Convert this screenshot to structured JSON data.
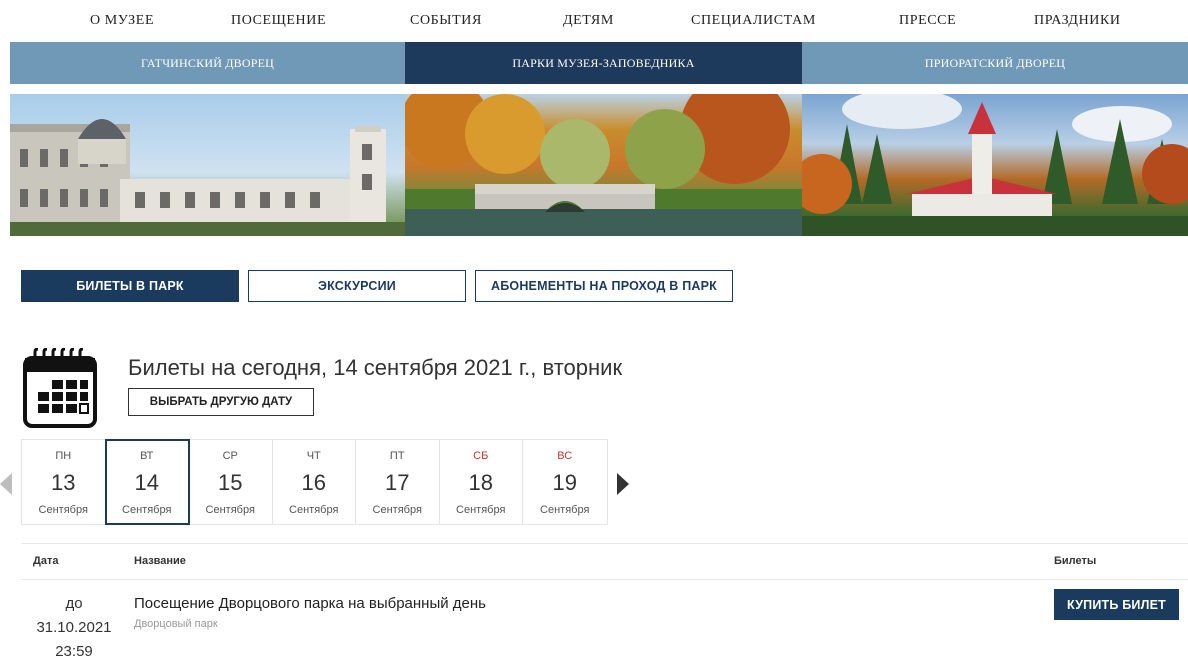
{
  "topnav": [
    "О МУЗЕЕ",
    "ПОСЕЩЕНИЕ",
    "СОБЫТИЯ",
    "ДЕТЯМ",
    "СПЕЦИАЛИСТАМ",
    "ПРЕССЕ",
    "ПРАЗДНИКИ"
  ],
  "subnav": [
    "ГАТЧИНСКИЙ ДВОРЕЦ",
    "ПАРКИ МУЗЕЯ-ЗАПОВЕДНИКА",
    "ПРИОРАТСКИЙ ДВОРЕЦ"
  ],
  "tabs": [
    "БИЛЕТЫ В ПАРК",
    "ЭКСКУРСИИ",
    "АБОНЕМЕНТЫ НА ПРОХОД В ПАРК"
  ],
  "calendar": {
    "heading": "Билеты на сегодня, 14 сентября 2021 г., вторник",
    "other_date_button": "ВЫБРАТЬ ДРУГУЮ ДАТУ",
    "days": [
      {
        "dow": "ПН",
        "num": "13",
        "month": "Сентября",
        "weekend": false,
        "active": false
      },
      {
        "dow": "ВТ",
        "num": "14",
        "month": "Сентября",
        "weekend": false,
        "active": true
      },
      {
        "dow": "СР",
        "num": "15",
        "month": "Сентября",
        "weekend": false,
        "active": false
      },
      {
        "dow": "ЧТ",
        "num": "16",
        "month": "Сентября",
        "weekend": false,
        "active": false
      },
      {
        "dow": "ПТ",
        "num": "17",
        "month": "Сентября",
        "weekend": false,
        "active": false
      },
      {
        "dow": "СБ",
        "num": "18",
        "month": "Сентября",
        "weekend": true,
        "active": false
      },
      {
        "dow": "ВС",
        "num": "19",
        "month": "Сентября",
        "weekend": true,
        "active": false
      }
    ]
  },
  "table": {
    "headers": {
      "date": "Дата",
      "name": "Название",
      "tickets": "Билеты"
    },
    "rows": [
      {
        "date_lines": [
          "до",
          "31.10.2021",
          "23:59"
        ],
        "title": "Посещение Дворцового парка на выбранный день",
        "subtitle": "Дворцовый парк",
        "buy_label": "КУПИТЬ БИЛЕТ"
      }
    ]
  },
  "colors": {
    "navy": "#1a3a5e",
    "steel": "#6f99b7",
    "weekend": "#c0392b"
  }
}
